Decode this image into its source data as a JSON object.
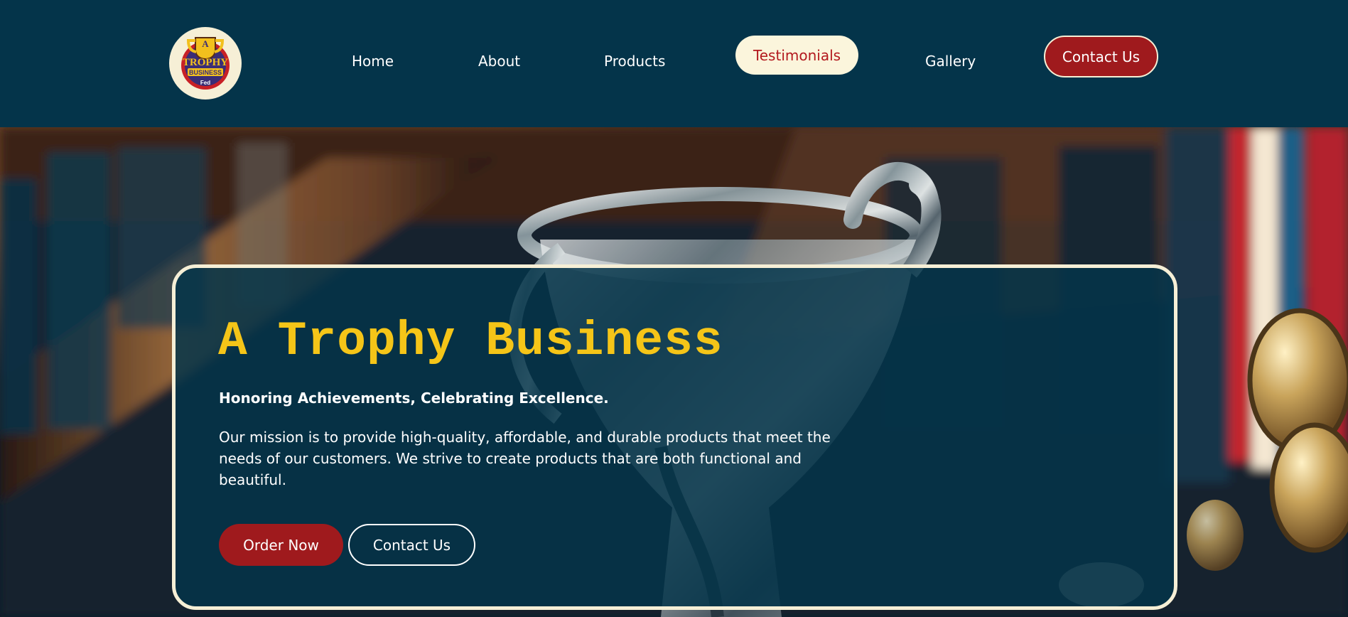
{
  "header": {
    "logo": {
      "badge_top": "A",
      "line1": "TROPHY",
      "line2": "BUSINESS",
      "line3": "Fed"
    },
    "nav": [
      {
        "label": "Home",
        "active": false
      },
      {
        "label": "About",
        "active": false
      },
      {
        "label": "Products",
        "active": false
      },
      {
        "label": "Testimonials",
        "active": true
      },
      {
        "label": "Gallery",
        "active": false
      }
    ],
    "contact_label": "Contact Us"
  },
  "hero": {
    "title": "A Trophy Business",
    "subtitle": "Honoring Achievements, Celebrating Excellence.",
    "description": "Our mission is to provide high-quality, affordable, and durable products that meet the needs of our customers. We strive to create products that are both functional and beautiful.",
    "primary_button": "Order Now",
    "secondary_button": "Contact Us"
  },
  "colors": {
    "navy": "#04344a",
    "cream": "#f6efd6",
    "red": "#9f1a1d",
    "gold": "#f5c518",
    "active_text": "#b3191e"
  },
  "icons": {
    "logo": "trophy-badge-logo"
  }
}
